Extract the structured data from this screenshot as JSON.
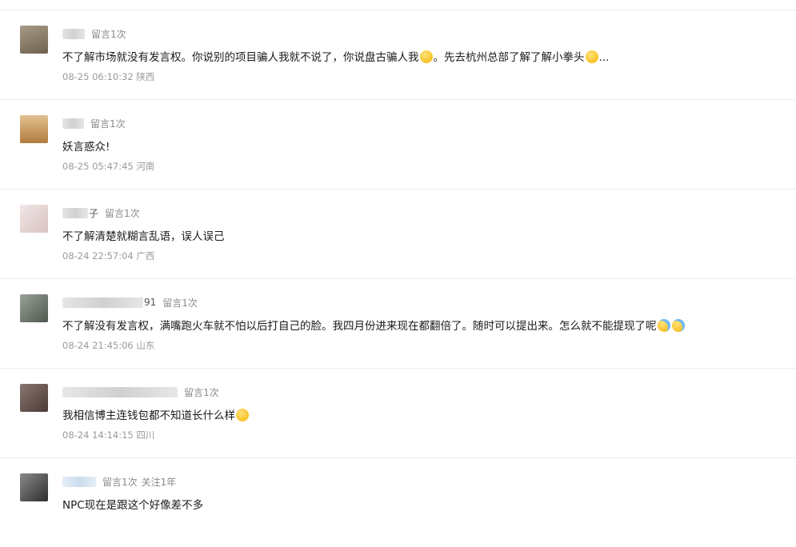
{
  "comments": [
    {
      "avatar_color": "#8b7d6b",
      "username_visible": "",
      "badge": "留言1次",
      "follow": "",
      "text_parts": [
        "不了解市场就没有发言权。你说别的项目骗人我就不说了，你说盘古骗人我",
        "。先去杭州总部了解了解小拳头",
        "..."
      ],
      "emojis": [
        "thinking-emoji-icon",
        "grin-emoji-icon"
      ],
      "timestamp": "08-25 06:10:32 陕西"
    },
    {
      "avatar_color": "#c99a5a",
      "username_visible": "",
      "badge": "留言1次",
      "follow": "",
      "text_parts": [
        "妖言惑众!"
      ],
      "emojis": [],
      "timestamp": "08-25 05:47:45 河南"
    },
    {
      "avatar_color": "#e8d7d7",
      "username_visible": "子",
      "badge": "留言1次",
      "follow": "",
      "text_parts": [
        "不了解清楚就糊言乱语，误人误己"
      ],
      "emojis": [],
      "timestamp": "08-24 22:57:04 广西"
    },
    {
      "avatar_color": "#707a70",
      "username_visible": "91",
      "badge": "留言1次",
      "follow": "",
      "text_parts": [
        "不了解没有发言权，满嘴跑火车就不怕以后打自己的脸。我四月份进来现在都翻倍了。随时可以提出来。怎么就不能提现了呢"
      ],
      "emojis": [
        "cry-laugh-emoji-icon",
        "cry-laugh-emoji-icon"
      ],
      "timestamp": "08-24 21:45:06 山东"
    },
    {
      "avatar_color": "#6d5a55",
      "username_visible": "",
      "badge": "留言1次",
      "follow": "",
      "text_parts": [
        "我相信博主连钱包都不知道长什么样"
      ],
      "emojis": [
        "grin-emoji-icon"
      ],
      "timestamp": "08-24 14:14:15 四川"
    },
    {
      "avatar_color": "#5a5a5a",
      "username_visible": "",
      "badge": "留言1次",
      "follow": "关注1年",
      "text_parts": [
        "NPC现在是跟这个好像差不多"
      ],
      "emojis": [],
      "timestamp": ""
    }
  ]
}
